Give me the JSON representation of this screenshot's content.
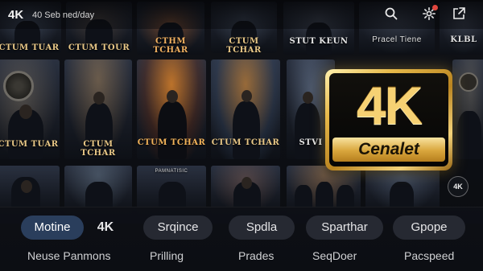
{
  "topbar": {
    "brand": "4K",
    "subtitle": "40 Seb ned/day",
    "icons": [
      "search-icon",
      "settings-icon",
      "share-icon"
    ],
    "notification_color": "#e0463e"
  },
  "posters": {
    "row1": [
      "CTUM TUAR",
      "CTUM TOUR",
      "CTHM TCHAR",
      "CTUM TCHAR",
      "STUT KEUN",
      "Pracel Tiene",
      "KLBL"
    ],
    "row2": [
      "CTUM TUAR",
      "CTUM TCHAR",
      "CTUM TCHAR",
      "CTUM TCHAR",
      "STVI"
    ],
    "row3": [
      "",
      "",
      "PAMNATISIC",
      "",
      "",
      ""
    ]
  },
  "badge": {
    "big_text": "4K",
    "name": "Cenalet",
    "gold": "#e7b94a"
  },
  "side_buttons": {
    "quality": "4K"
  },
  "panel": {
    "chips": [
      {
        "label": "Motine",
        "active": true
      },
      {
        "label": "4K",
        "active": false
      },
      {
        "label": "Srqince",
        "active": false
      },
      {
        "label": "Spdla",
        "active": false
      },
      {
        "label": "Sparthar",
        "active": false
      },
      {
        "label": "Gpope",
        "active": false
      }
    ],
    "sublabels": [
      "Neuse Panmons",
      "Prilling",
      "Prades",
      "SeqDoer",
      "Pacspeed"
    ]
  },
  "colors": {
    "background": "#0b0d12",
    "poster_title": "#e9c887",
    "active_chip": "#2a3e5c"
  }
}
